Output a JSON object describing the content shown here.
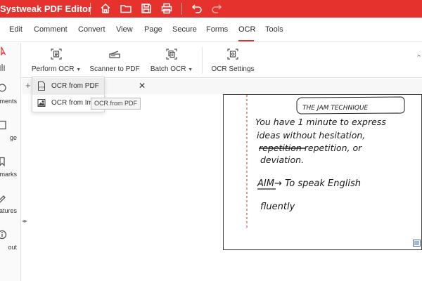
{
  "app": {
    "title": "Systweak PDF Editor"
  },
  "titlebar_icons": [
    "home-icon",
    "folder-icon",
    "save-icon",
    "print-icon",
    "undo-icon",
    "redo-icon"
  ],
  "menu": {
    "items": [
      "Edit",
      "Comment",
      "Convert",
      "View",
      "Page",
      "Secure",
      "Forms",
      "OCR",
      "Tools"
    ],
    "active": "OCR"
  },
  "ribbon": {
    "perform_ocr": "Perform OCR",
    "scanner_to_pdf": "Scanner to PDF",
    "batch_ocr": "Batch OCR",
    "ocr_settings": "OCR Settings"
  },
  "sidebar": {
    "items": [
      "ments",
      "ge",
      "marks",
      "atures",
      "out"
    ]
  },
  "dropdown": {
    "items": [
      "OCR from PDF",
      "OCR from Im"
    ],
    "tooltip": "OCR from PDF"
  },
  "document": {
    "lines": [
      "THE JAM TECHNIQUE",
      "You have 1 minute to express",
      "ideas without hesitation,",
      "repetition repetition, or",
      "deviation.",
      "AIM→ To speak English",
      "fluently"
    ]
  },
  "colors": {
    "accent": "#e5322d"
  }
}
